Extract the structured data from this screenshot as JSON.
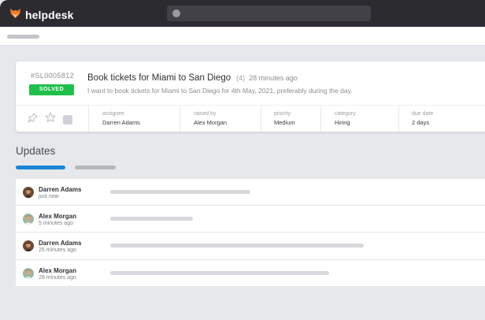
{
  "app": {
    "name": "helpdesk",
    "brand_color": "#f07b2b"
  },
  "ticket": {
    "id": "#SL0005812",
    "status": "SOLVED",
    "status_color": "#1fc04a",
    "title": "Book tickets for Miami to San Diego",
    "count": "(4)",
    "time": "28 minutes ago",
    "description": "I want to book tickets for Miami to San Diego for 4th May, 2021, preferably during the day.",
    "fields": [
      {
        "label": "assignee",
        "value": "Darren Adams"
      },
      {
        "label": "raised by",
        "value": "Alex Morgan"
      },
      {
        "label": "priority",
        "value": "Medium"
      },
      {
        "label": "category",
        "value": "Hiring"
      },
      {
        "label": "due date",
        "value": "2 days"
      }
    ]
  },
  "updates": {
    "title": "Updates",
    "items": [
      {
        "name": "Darren Adams",
        "ago": "just now",
        "avatar": "darren",
        "message_fill": 0.32
      },
      {
        "name": "Alex Morgan",
        "ago": "5 minutes ago",
        "avatar": "alex",
        "message_fill": 0.19
      },
      {
        "name": "Darren Adams",
        "ago": "25 minutes ago",
        "avatar": "darren",
        "message_fill": 0.58
      },
      {
        "name": "Alex Morgan",
        "ago": "28 minutes ago",
        "avatar": "alex",
        "message_fill": 0.5
      }
    ]
  },
  "icons": [
    "fox-logo-icon",
    "search-icon",
    "pin-icon",
    "star-icon",
    "square-icon",
    "avatar-icon"
  ]
}
